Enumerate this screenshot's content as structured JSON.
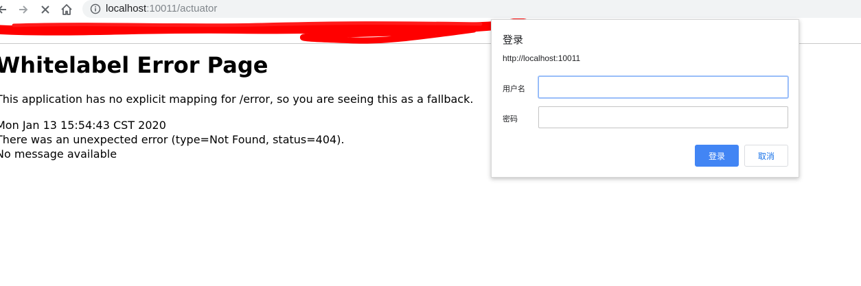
{
  "browser": {
    "url_host": "localhost",
    "url_path": ":10011/actuator",
    "icons": {
      "back": "arrow-left-icon",
      "forward": "arrow-right-icon",
      "stop": "close-icon",
      "home": "home-icon",
      "info": "info-icon"
    }
  },
  "page": {
    "heading": "Whitelabel Error Page",
    "paragraph": "This application has no explicit mapping for /error, so you are seeing this as a fallback.",
    "lines": [
      "Mon Jan 13 15:54:43 CST 2020",
      "There was an unexpected error (type=Not Found, status=404).",
      "No message available"
    ]
  },
  "dialog": {
    "title": "登录",
    "origin": "http://localhost:10011",
    "username_label": "用户名",
    "username_value": "",
    "password_label": "密码",
    "password_value": "",
    "login_button": "登录",
    "cancel_button": "取消"
  },
  "colors": {
    "accent": "#4285f4",
    "scribble": "#ff0000",
    "cancel_text": "#1a73e8"
  }
}
